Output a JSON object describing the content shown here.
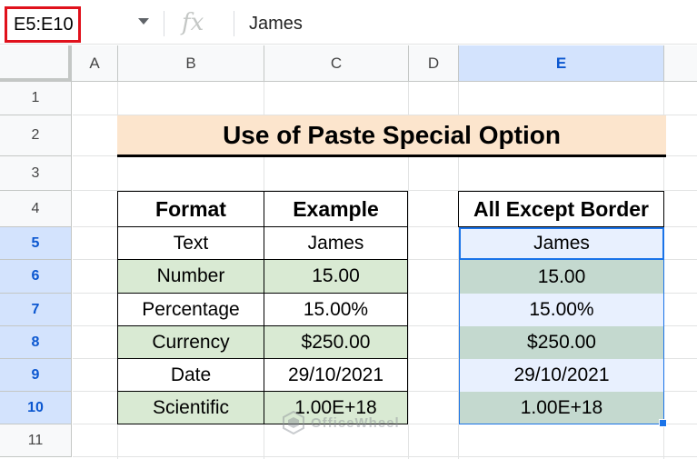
{
  "formula_bar": {
    "name_box": "E5:E10",
    "fx_label": "fx",
    "value": "James"
  },
  "columns": [
    "A",
    "B",
    "C",
    "D",
    "E"
  ],
  "rows": [
    "1",
    "2",
    "3",
    "4",
    "5",
    "6",
    "7",
    "8",
    "9",
    "10",
    "11"
  ],
  "title": "Use of Paste Special Option",
  "format_table": {
    "headers": [
      "Format",
      "Example"
    ],
    "rows": [
      [
        "Text",
        "James"
      ],
      [
        "Number",
        "15.00"
      ],
      [
        "Percentage",
        "15.00%"
      ],
      [
        "Currency",
        "$250.00"
      ],
      [
        "Date",
        "29/10/2021"
      ],
      [
        "Scientific",
        "1.00E+18"
      ]
    ]
  },
  "result_table": {
    "header": "All Except Border",
    "values": [
      "James",
      "15.00",
      "15.00%",
      "$250.00",
      "29/10/2021",
      "1.00E+18"
    ]
  },
  "watermark": "OfficeWheel",
  "colors": {
    "selection": "#1a73e8",
    "title_fill": "#fce5cd",
    "green_fill": "#d9ead3",
    "name_box_highlight": "#e0111c"
  }
}
